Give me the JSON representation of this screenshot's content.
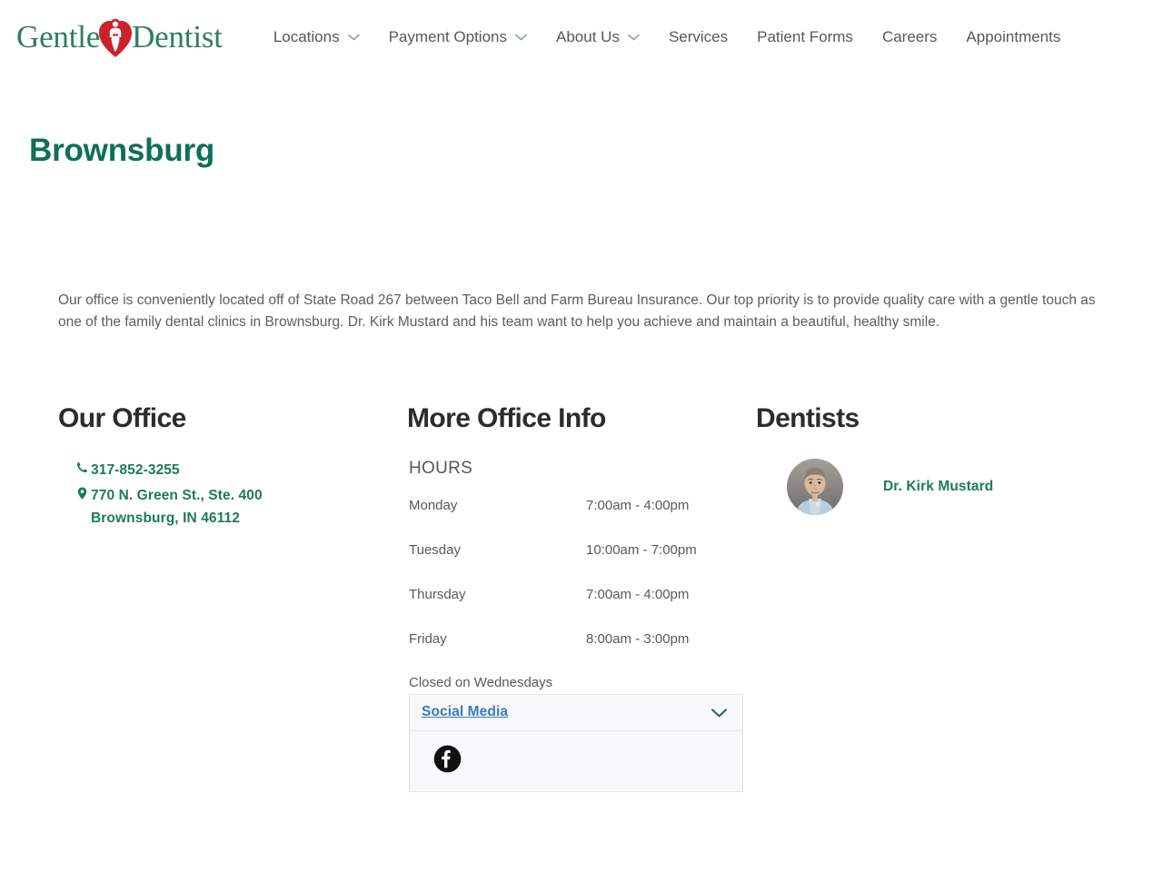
{
  "header": {
    "brand": {
      "word_left": "Gentle",
      "word_right": "Dentist",
      "mark_icon": "heart-tooth-logo-icon"
    },
    "nav": [
      {
        "label": "Locations",
        "has_caret": true,
        "caret_icon": "chevron-down-icon"
      },
      {
        "label": "Payment Options",
        "has_caret": true,
        "caret_icon": "chevron-down-icon"
      },
      {
        "label": "About Us",
        "has_caret": true,
        "caret_icon": "chevron-down-icon"
      },
      {
        "label": "Services",
        "has_caret": false,
        "caret_icon": ""
      },
      {
        "label": "Patient Forms",
        "has_caret": false,
        "caret_icon": ""
      },
      {
        "label": "Careers",
        "has_caret": false,
        "caret_icon": ""
      },
      {
        "label": "Appointments",
        "has_caret": false,
        "caret_icon": ""
      }
    ]
  },
  "page": {
    "title": "Brownsburg",
    "intro": "Our office is conveniently located off of State Road 267 between Taco Bell and Farm Bureau Insurance. Our top priority is to provide quality care with a gentle touch as one of the family dental clinics in Brownsburg. Dr. Kirk Mustard and his team want to help you achieve and maintain a beautiful, healthy smile."
  },
  "office": {
    "heading": "Our Office",
    "phone": {
      "icon": "phone-icon",
      "value": "317-852-3255"
    },
    "address": {
      "icon": "map-pin-icon",
      "line1": "770 N. Green St., Ste. 400",
      "line2": "Brownsburg, IN 46112"
    }
  },
  "more_info": {
    "heading": "More Office Info",
    "hours_label": "HOURS",
    "hours": [
      {
        "day": "Monday",
        "time": "7:00am - 4:00pm"
      },
      {
        "day": "Tuesday",
        "time": "10:00am - 7:00pm"
      },
      {
        "day": "Thursday",
        "time": "7:00am - 4:00pm"
      },
      {
        "day": "Friday",
        "time": "8:00am - 3:00pm"
      }
    ],
    "closed_note": "Closed on Wednesdays",
    "social": {
      "title": "Social Media",
      "toggle_icon": "chevron-down-icon",
      "links": [
        {
          "name": "Facebook",
          "icon": "facebook-icon"
        }
      ]
    }
  },
  "dentists": {
    "heading": "Dentists",
    "list": [
      {
        "name": "Dr. Kirk Mustard",
        "avatar_icon": "dentist-headshot-avatar"
      }
    ]
  },
  "colors": {
    "brand_green": "#2f7d5f",
    "title_green": "#0e7055",
    "link_green": "#1d7a5f",
    "logo_red": "#cc2229",
    "nav_gray": "#54585c",
    "body_gray": "#5a5e62",
    "heading_dark": "#2c2c2c",
    "social_blue": "#3b7cb5",
    "panel_bg": "#f7f8f9",
    "panel_border": "#e4e6e8",
    "facebook_black": "#111111"
  }
}
